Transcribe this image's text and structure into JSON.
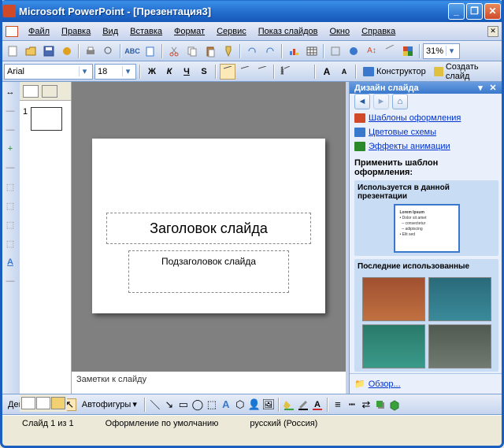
{
  "title": "Microsoft PowerPoint - [Презентация3]",
  "menu": {
    "file": "Файл",
    "edit": "Правка",
    "view": "Вид",
    "insert": "Вставка",
    "format": "Формат",
    "tools": "Сервис",
    "slideshow": "Показ слайдов",
    "window": "Окно",
    "help": "Справка"
  },
  "zoom": "31%",
  "format": {
    "font": "Arial",
    "size": "18",
    "bold": "Ж",
    "italic": "К",
    "underline": "Ч",
    "shadow": "S",
    "designer": "Конструктор",
    "newslide": "Создать слайд"
  },
  "outline": {
    "slidenum": "1"
  },
  "slide": {
    "title": "Заголовок слайда",
    "subtitle": "Подзаголовок слайда"
  },
  "notes": "Заметки к слайду",
  "taskpane": {
    "title": "Дизайн слайда",
    "link1": "Шаблоны оформления",
    "link2": "Цветовые схемы",
    "link3": "Эффекты анимации",
    "apply": "Применить шаблон оформления:",
    "used": "Используется в данной презентации",
    "recent": "Последние использованные",
    "browse": "Обзор..."
  },
  "drawbar": {
    "actions": "Действия",
    "autoshapes": "Автофигуры"
  },
  "status": {
    "slide": "Слайд 1 из 1",
    "design": "Оформление по умолчанию",
    "lang": "русский (Россия)"
  }
}
